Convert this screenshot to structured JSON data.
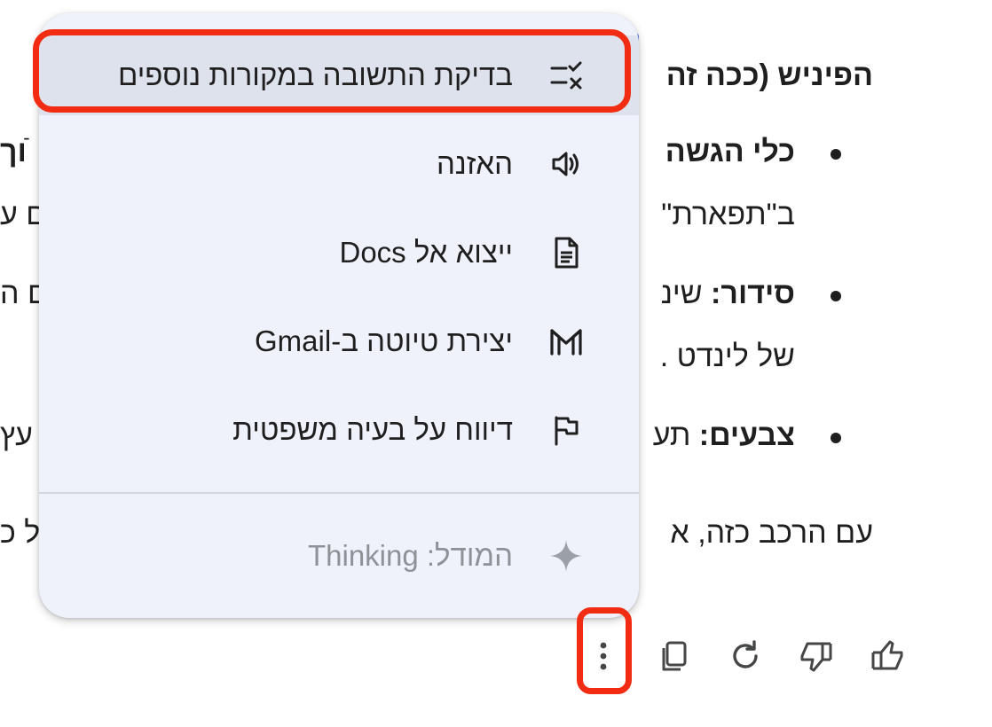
{
  "response": {
    "heading": "הפיניש (ככה זה",
    "bullet1_bold": "כלי הגשה",
    "bullet1_line2": "ב\"תפארת\"",
    "bullet2_bold": "סידור:",
    "bullet2_rest": " שינ",
    "bullet2_line2": "של לינדט .",
    "bullet3_bold": "צבעים:",
    "bullet3_rest": " תע",
    "closing": "עם הרכב כזה, א",
    "left_fragments": {
      "row1": "ֿוך",
      "row2": "ם ע",
      "row3": "ם ה",
      "row4": "עץ",
      "row5": "ל כ"
    }
  },
  "menu": {
    "items": [
      {
        "label": "בדיקת התשובה במקורות נוספים",
        "icon": "double-check-icon"
      },
      {
        "label": "האזנה",
        "icon": "speaker-icon"
      },
      {
        "label": "ייצוא אל Docs",
        "icon": "document-icon"
      },
      {
        "label": "יצירת טיוטה ב-Gmail",
        "icon": "gmail-icon"
      },
      {
        "label": "דיווח על בעיה משפטית",
        "icon": "flag-icon"
      }
    ],
    "model_label": "המודל: Thinking",
    "model_icon": "sparkle-icon"
  },
  "actions": {
    "more": "more-vert-icon",
    "copy": "copy-icon",
    "redo": "redo-icon",
    "thumbs_down": "thumbs-down-icon",
    "thumbs_up": "thumbs-up-icon"
  },
  "colors": {
    "menu_bg": "#eff2fa",
    "menu_hover": "#dee2ec",
    "annotation_red": "#f12c13",
    "text": "#1f1f1f",
    "muted": "#8e9196"
  }
}
